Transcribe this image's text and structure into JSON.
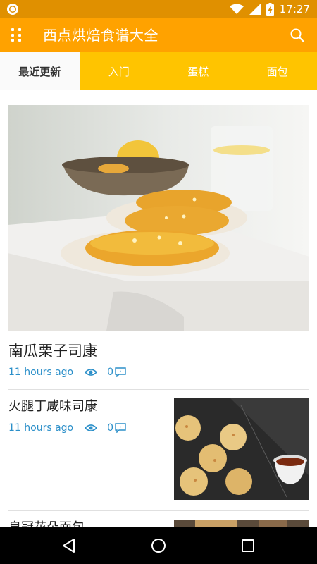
{
  "status_bar": {
    "time": "17:27",
    "icons": [
      "record-icon",
      "wifi-icon",
      "signal-icon",
      "battery-charging-icon"
    ]
  },
  "app_bar": {
    "title": "西点烘焙食谱大全",
    "menu_icon": "grid-dots-icon",
    "search_icon": "search-icon",
    "color": "#ffa200"
  },
  "tabs": [
    {
      "label": "最近更新",
      "active": true
    },
    {
      "label": "入门",
      "active": false
    },
    {
      "label": "蛋糕",
      "active": false
    },
    {
      "label": "面包",
      "active": false
    }
  ],
  "tabs_color": "#ffc400",
  "articles": [
    {
      "title": "南瓜栗子司康",
      "time": "11 hours ago",
      "comments": "0",
      "image": "pumpkin-scones-photo"
    },
    {
      "title": "火腿丁咸味司康",
      "time": "11 hours ago",
      "comments": "0",
      "image": "ham-scones-photo"
    },
    {
      "title": "皇冠花朵面包",
      "image": "crown-bread-photo"
    }
  ],
  "accent_color": "#2b8fc9",
  "nav_bar": {
    "icons": [
      "back-icon",
      "home-icon",
      "recents-icon"
    ]
  }
}
